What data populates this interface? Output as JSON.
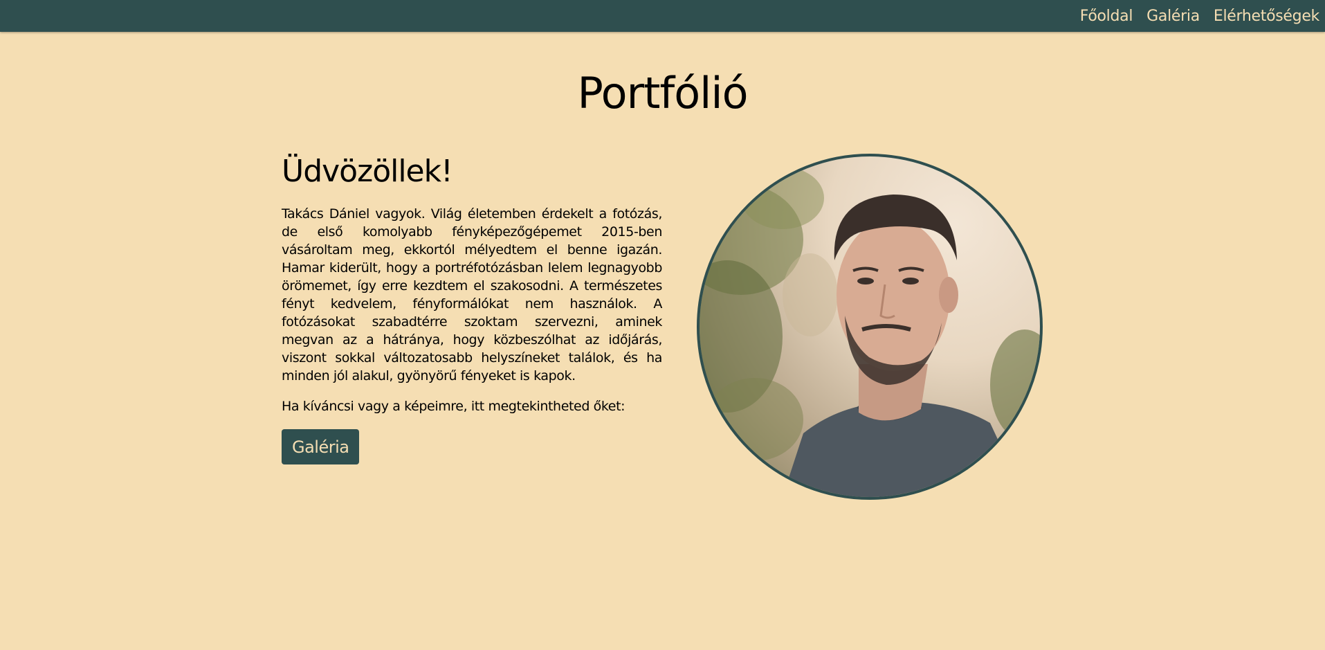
{
  "nav": {
    "items": [
      {
        "label": "Főoldal"
      },
      {
        "label": "Galéria"
      },
      {
        "label": "Elérhetőségek"
      }
    ]
  },
  "page": {
    "title": "Portfólió"
  },
  "intro": {
    "heading": "Üdvözöllek!",
    "bio": "Takács Dániel vagyok. Világ életemben érdekelt a fotózás, de első komolyabb fényképezőgépemet 2015-ben vásároltam meg, ekkortól mélyedtem el benne igazán. Hamar kiderült, hogy a portréfotózásban lelem legnagyobb örömemet, így erre kezdtem el szakosodni. A természetes fényt kedvelem, fényformálókat nem használok. A fotózásokat szabadtérre szoktam szervezni, aminek megvan az a hátránya, hogy közbeszólhat az időjárás, viszont sokkal változatosabb helyszíneket találok, és ha minden jól alakul, gyönyörű fényeket is kapok.",
    "cta_text": "Ha kíváncsi vagy a képeimre, itt megtekintheted őket:",
    "button_label": "Galéria"
  },
  "colors": {
    "background": "#f5deb3",
    "primary": "#2f4f4f",
    "text": "#000000"
  },
  "icons": {
    "portrait": "portrait-photo"
  }
}
